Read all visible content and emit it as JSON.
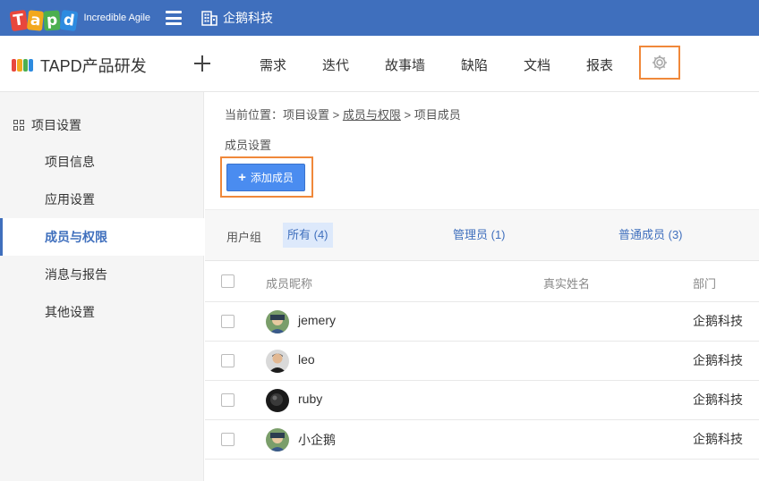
{
  "topbar": {
    "logo_letters": [
      "T",
      "a",
      "p",
      "d"
    ],
    "slogan": "Incredible Agile",
    "org_name": "企鹅科技",
    "bg_color": "#3f6fbd"
  },
  "project": {
    "title": "TAPD产品研发",
    "nav": [
      "需求",
      "迭代",
      "故事墙",
      "缺陷",
      "文档",
      "报表"
    ]
  },
  "sidebar": {
    "heading": "项目设置",
    "items": [
      {
        "label": "项目信息"
      },
      {
        "label": "应用设置"
      },
      {
        "label": "成员与权限",
        "active": true
      },
      {
        "label": "消息与报告"
      },
      {
        "label": "其他设置"
      }
    ]
  },
  "main": {
    "breadcrumb": {
      "prefix": "当前位置：",
      "level1": "项目设置",
      "sep": " > ",
      "level2": "成员与权限",
      "level3": "项目成员"
    },
    "section_label": "成员设置",
    "add_button": "添加成员",
    "filter": {
      "label": "用户组",
      "tabs": [
        {
          "label": "所有 (4)",
          "active": true
        },
        {
          "label": "管理员 (1)"
        },
        {
          "label": "普通成员 (3)"
        }
      ]
    },
    "table": {
      "headers": [
        "成员昵称",
        "真实姓名",
        "部门"
      ],
      "rows": [
        {
          "nickname": "jemery",
          "real_name": "",
          "dept": "企鹅科技"
        },
        {
          "nickname": "leo",
          "real_name": "",
          "dept": "企鹅科技"
        },
        {
          "nickname": "ruby",
          "real_name": "",
          "dept": "企鹅科技"
        },
        {
          "nickname": "小企鹅",
          "real_name": "",
          "dept": "企鹅科技"
        }
      ]
    }
  },
  "colors": {
    "accent": "#3f6fbd",
    "button": "#4a8cf0",
    "highlight_outline": "#f0883a"
  }
}
